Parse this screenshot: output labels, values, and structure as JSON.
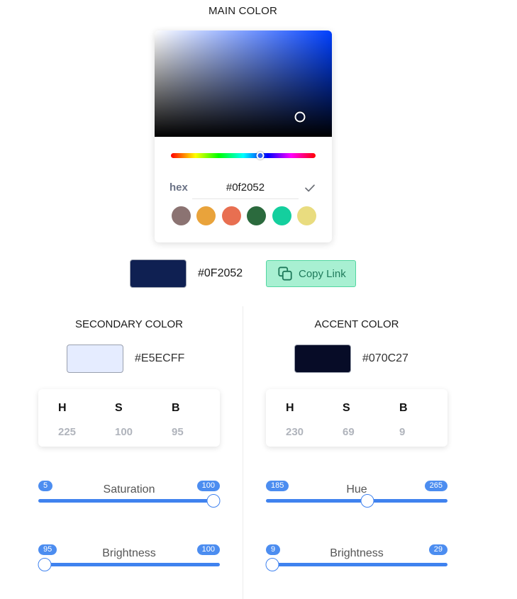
{
  "main": {
    "title": "MAIN COLOR",
    "hex_label": "hex",
    "hex_value": "#0f2052",
    "preview_color": "#0F2052",
    "preview_hex": "#0F2052",
    "hue_position": 0.62,
    "sv_saturation": 0.82,
    "sv_brightness": 0.19,
    "swatches": [
      {
        "name": "swatch-mauve",
        "color": "#8b7372"
      },
      {
        "name": "swatch-orange",
        "color": "#e9a33b"
      },
      {
        "name": "swatch-coral",
        "color": "#e86f51"
      },
      {
        "name": "swatch-dark-green",
        "color": "#2b6a3d"
      },
      {
        "name": "swatch-teal",
        "color": "#14cf9e"
      },
      {
        "name": "swatch-yellow",
        "color": "#e9dc7f"
      }
    ],
    "copy_button_label": "Copy Link"
  },
  "secondary": {
    "title": "SECONDARY COLOR",
    "hex": "#E5ECFF",
    "preview_color": "#E5ECFF",
    "hsb": {
      "h_label": "H",
      "s_label": "S",
      "b_label": "B",
      "h": "225",
      "s": "100",
      "b": "95"
    },
    "slider1": {
      "label": "Saturation",
      "min": "5",
      "max": "100",
      "value": 100
    },
    "slider2": {
      "label": "Brightness",
      "min": "95",
      "max": "100",
      "value": 95
    }
  },
  "accent": {
    "title": "ACCENT COLOR",
    "hex": "#070C27",
    "preview_color": "#070C27",
    "hsb": {
      "h_label": "H",
      "s_label": "S",
      "b_label": "B",
      "h": "230",
      "s": "69",
      "b": "9"
    },
    "slider1": {
      "label": "Hue",
      "min": "185",
      "max": "265",
      "value": 230
    },
    "slider2": {
      "label": "Brightness",
      "min": "9",
      "max": "29",
      "value": 9
    }
  },
  "colors": {
    "accent_blue": "#3f82ef",
    "copy_button_bg": "#a8f0d2",
    "copy_button_text": "#1f7a5b"
  }
}
